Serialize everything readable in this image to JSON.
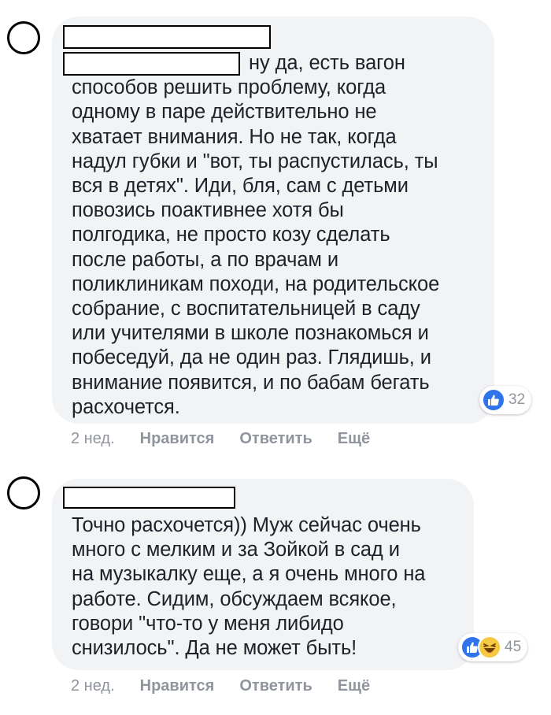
{
  "comments": [
    {
      "text_first": "ну да, есть вагон",
      "text_rest": "способов решить проблему, когда\nодному в паре действительно не\nхватает внимания. Но не так, когда\nнадул губки и \"вот, ты распустилась, ты\nвся в детях\". Иди, бля, сам с детьми\nповозись поактивнее хотя бы\nполгодика, не просто козу сделать\nпосле работы, а по врачам и\nполиклиникам походи, на родительское\nсобрание, с воспитательницей в саду\nили учителями в школе познакомься и\nпобеседуй, да не один раз. Глядишь, и\nвнимание появится, и по бабам бегать\nрасхочется.",
      "reaction_count": "32",
      "reactions": [
        "like-icon"
      ],
      "time": "2 нед.",
      "like_label": "Нравится",
      "reply_label": "Ответить",
      "more_label": "Ещё"
    },
    {
      "text": "Точно расхочется)) Муж сейчас очень\nмного с мелким и за Зойкой в сад и\nна музыкалку еще, а я очень много на\nработе. Сидим, обсуждаем всякое,\nговори \"что-то у меня либидо\nснизилось\". Да не может быть!",
      "reaction_count": "45",
      "reactions": [
        "like-icon",
        "haha-icon"
      ],
      "time": "2 нед.",
      "like_label": "Нравится",
      "reply_label": "Ответить",
      "more_label": "Ещё"
    }
  ],
  "colors": {
    "bubble": "#f2f3f5",
    "text": "#1d2129",
    "meta": "#90949c",
    "like_blue": "#2f74ea",
    "haha_yellow": "#f7c942"
  }
}
